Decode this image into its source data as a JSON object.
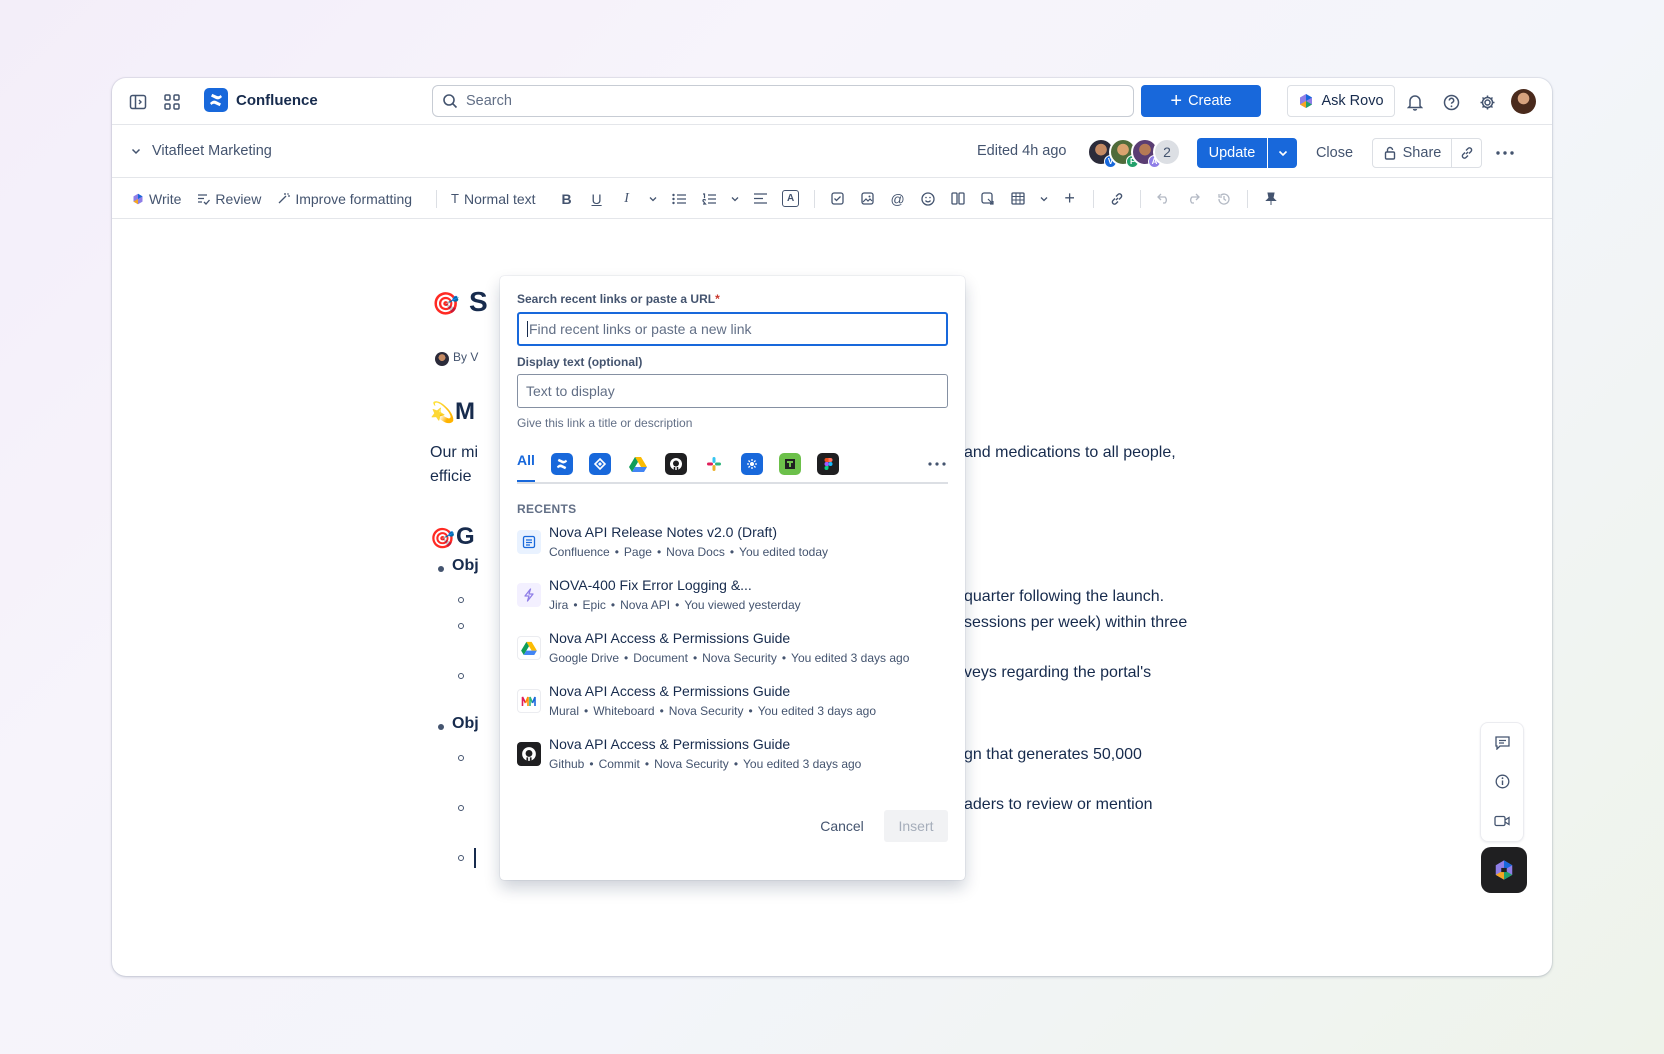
{
  "app": {
    "name": "Confluence"
  },
  "topnav": {
    "search_placeholder": "Search",
    "create_label": "Create",
    "ask_rovo_label": "Ask Rovo"
  },
  "pagebar": {
    "space_name": "Vitafleet Marketing",
    "edited": "Edited 4h ago",
    "collaborators": [
      {
        "initial": "V",
        "color": "#1868db"
      },
      {
        "initial": "F",
        "color": "#22a06b"
      },
      {
        "initial": "A",
        "color": "#8f7ee7"
      }
    ],
    "collaborator_count": "2",
    "update_label": "Update",
    "close_label": "Close",
    "share_label": "Share"
  },
  "toolbar": {
    "write": "Write",
    "review": "Review",
    "improve": "Improve formatting",
    "text_style": "Normal text"
  },
  "document": {
    "title_initial": "S",
    "byline": "By V",
    "heading1": "M",
    "heading1_emoji": "💫",
    "para1_left": "Our mi",
    "para1_right": "and medications to all people,",
    "para1_line2": "efficie",
    "heading2": "G",
    "heading2_emoji": "🎯",
    "obj1": "Obj",
    "obj1_sub1_right": "quarter following the launch.",
    "obj1_sub2_right": "sessions per week) within three",
    "obj1_sub3_right": "veys regarding the portal's",
    "obj2": "Obj",
    "obj2_sub1_right": "gn that generates 50,000",
    "obj2_sub2_right": "aders to review or mention"
  },
  "link_dialog": {
    "url_label": "Search recent links or paste a URL",
    "required_mark": "*",
    "url_placeholder": "Find recent links or paste a new link",
    "display_label": "Display text (optional)",
    "display_placeholder": "Text to display",
    "display_helper": "Give this link a title or description",
    "tab_all": "All",
    "recents_heading": "RECENTS",
    "items": [
      {
        "title": "Nova API Release Notes v2.0 (Draft)",
        "meta": [
          "Confluence",
          "Page",
          "Nova Docs",
          "You edited today"
        ],
        "icon": "confluence-page-icon"
      },
      {
        "title": "NOVA-400 Fix Error Logging &...",
        "meta": [
          "Jira",
          "Epic",
          "Nova API",
          "You viewed yesterday"
        ],
        "icon": "jira-epic-icon"
      },
      {
        "title": "Nova API Access & Permissions Guide",
        "meta": [
          "Google Drive",
          "Document",
          "Nova Security",
          "You edited 3 days ago"
        ],
        "icon": "google-drive-icon"
      },
      {
        "title": "Nova API Access & Permissions Guide",
        "meta": [
          "Mural",
          "Whiteboard",
          "Nova Security",
          "You edited 3 days ago"
        ],
        "icon": "mural-icon"
      },
      {
        "title": "Nova API Access & Permissions Guide",
        "meta": [
          "Github",
          "Commit",
          "Nova Security",
          "You edited 3 days ago"
        ],
        "icon": "github-icon"
      }
    ],
    "cancel_label": "Cancel",
    "insert_label": "Insert"
  },
  "colors": {
    "brand": "#1868db",
    "text": "#172b4d",
    "subtle": "#44546f"
  }
}
